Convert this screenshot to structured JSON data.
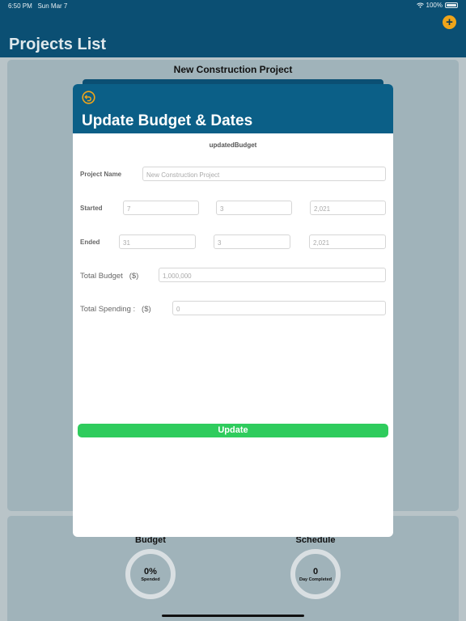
{
  "status_bar": {
    "time": "6:50 PM",
    "date": "Sun Mar 7",
    "battery": "100%"
  },
  "header": {
    "title": "Projects List",
    "add_icon": "plus-circle-icon"
  },
  "project_card": {
    "title": "New Construction Project"
  },
  "summary": {
    "budget_label": "Budget",
    "budget_value": "0%",
    "budget_caption": "Spended",
    "schedule_label": "Schedule",
    "schedule_value": "0",
    "schedule_caption": "Day Completed"
  },
  "modal": {
    "title": "Update Budget & Dates",
    "subtitle": "updatedBudget",
    "back_icon": "back-arrow-circle-icon",
    "project_name_label": "Project Name",
    "project_name_placeholder": "New Construction Project",
    "started_label": "Started",
    "started_day": "7",
    "started_month": "3",
    "started_year": "2,021",
    "ended_label": "Ended",
    "ended_day": "31",
    "ended_month": "3",
    "ended_year": "2,021",
    "total_budget_label": "Total Budget   ($)",
    "total_budget_value": "1,000,000",
    "total_spending_label": "Total Spending :   ($)",
    "total_spending_value": "0",
    "update_label": "Update"
  },
  "colors": {
    "header": "#0b4f73",
    "accent": "#f0a51a",
    "button": "#2fcc5d"
  }
}
